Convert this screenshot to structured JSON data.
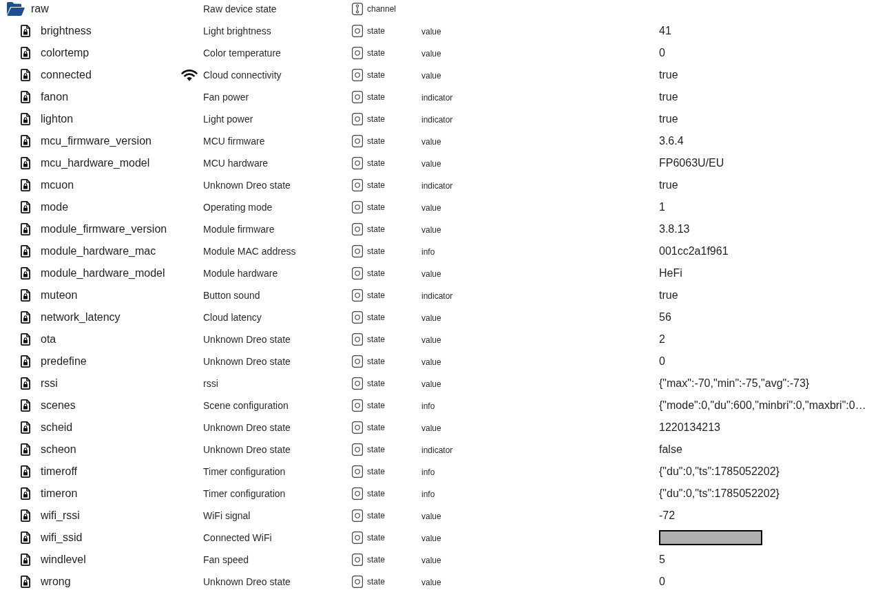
{
  "tree": {
    "name": "raw",
    "kind": "channel",
    "expanded": true,
    "has_icon": false,
    "description": "Raw device state",
    "type": "channel",
    "children": [
      {
        "name": "brightness",
        "kind": "state",
        "has_icon": false,
        "description": "Light brightness",
        "type": "state",
        "role": "value",
        "value": "41",
        "redacted": false
      },
      {
        "name": "colortemp",
        "kind": "state",
        "has_icon": false,
        "description": "Color temperature",
        "type": "state",
        "role": "value",
        "value": "0",
        "redacted": false
      },
      {
        "name": "connected",
        "kind": "state",
        "has_icon": true,
        "description": "Cloud connectivity",
        "type": "state",
        "role": "value",
        "value": "true",
        "redacted": false
      },
      {
        "name": "fanon",
        "kind": "state",
        "has_icon": false,
        "description": "Fan power",
        "type": "state",
        "role": "indicator",
        "value": "true",
        "redacted": false
      },
      {
        "name": "lighton",
        "kind": "state",
        "has_icon": false,
        "description": "Light power",
        "type": "state",
        "role": "indicator",
        "value": "true",
        "redacted": false
      },
      {
        "name": "mcu_firmware_version",
        "kind": "state",
        "has_icon": false,
        "description": "MCU firmware",
        "type": "state",
        "role": "value",
        "value": "3.6.4",
        "redacted": false
      },
      {
        "name": "mcu_hardware_model",
        "kind": "state",
        "has_icon": false,
        "description": "MCU hardware",
        "type": "state",
        "role": "value",
        "value": "FP6063U/EU",
        "redacted": false
      },
      {
        "name": "mcuon",
        "kind": "state",
        "has_icon": false,
        "description": "Unknown Dreo state",
        "type": "state",
        "role": "indicator",
        "value": "true",
        "redacted": false
      },
      {
        "name": "mode",
        "kind": "state",
        "has_icon": false,
        "description": "Operating mode",
        "type": "state",
        "role": "value",
        "value": "1",
        "redacted": false
      },
      {
        "name": "module_firmware_version",
        "kind": "state",
        "has_icon": false,
        "description": "Module firmware",
        "type": "state",
        "role": "value",
        "value": "3.8.13",
        "redacted": false
      },
      {
        "name": "module_hardware_mac",
        "kind": "state",
        "has_icon": false,
        "description": "Module MAC address",
        "type": "state",
        "role": "info",
        "value": "001cc2a1f961",
        "redacted": false
      },
      {
        "name": "module_hardware_model",
        "kind": "state",
        "has_icon": false,
        "description": "Module hardware",
        "type": "state",
        "role": "value",
        "value": "HeFi",
        "redacted": false
      },
      {
        "name": "muteon",
        "kind": "state",
        "has_icon": false,
        "description": "Button sound",
        "type": "state",
        "role": "indicator",
        "value": "true",
        "redacted": false
      },
      {
        "name": "network_latency",
        "kind": "state",
        "has_icon": false,
        "description": "Cloud latency",
        "type": "state",
        "role": "value",
        "value": "56",
        "redacted": false
      },
      {
        "name": "ota",
        "kind": "state",
        "has_icon": false,
        "description": "Unknown Dreo state",
        "type": "state",
        "role": "value",
        "value": "2",
        "redacted": false
      },
      {
        "name": "predefine",
        "kind": "state",
        "has_icon": false,
        "description": "Unknown Dreo state",
        "type": "state",
        "role": "value",
        "value": "0",
        "redacted": false
      },
      {
        "name": "rssi",
        "kind": "state",
        "has_icon": false,
        "description": "rssi",
        "type": "state",
        "role": "value",
        "value": "{\"max\":-70,\"min\":-75,\"avg\":-73}",
        "redacted": false
      },
      {
        "name": "scenes",
        "kind": "state",
        "has_icon": false,
        "description": "Scene configuration",
        "type": "state",
        "role": "info",
        "value": "{\"mode\":0,\"du\":600,\"minbri\":0,\"maxbri\":0…",
        "redacted": false
      },
      {
        "name": "scheid",
        "kind": "state",
        "has_icon": false,
        "description": "Unknown Dreo state",
        "type": "state",
        "role": "value",
        "value": "1220134213",
        "redacted": false
      },
      {
        "name": "scheon",
        "kind": "state",
        "has_icon": false,
        "description": "Unknown Dreo state",
        "type": "state",
        "role": "indicator",
        "value": "false",
        "redacted": false
      },
      {
        "name": "timeroff",
        "kind": "state",
        "has_icon": false,
        "description": "Timer configuration",
        "type": "state",
        "role": "info",
        "value": "{\"du\":0,\"ts\":1785052202}",
        "redacted": false
      },
      {
        "name": "timeron",
        "kind": "state",
        "has_icon": false,
        "description": "Timer configuration",
        "type": "state",
        "role": "info",
        "value": "{\"du\":0,\"ts\":1785052202}",
        "redacted": false
      },
      {
        "name": "wifi_rssi",
        "kind": "state",
        "has_icon": false,
        "description": "WiFi signal",
        "type": "state",
        "role": "value",
        "value": "-72",
        "redacted": false
      },
      {
        "name": "wifi_ssid",
        "kind": "state",
        "has_icon": false,
        "description": "Connected WiFi",
        "type": "state",
        "role": "value",
        "redacted": true
      },
      {
        "name": "windlevel",
        "kind": "state",
        "has_icon": false,
        "description": "Fan speed",
        "type": "state",
        "role": "value",
        "value": "5",
        "redacted": false
      },
      {
        "name": "wrong",
        "kind": "state",
        "has_icon": false,
        "description": "Unknown Dreo state",
        "type": "state",
        "role": "value",
        "value": "0",
        "redacted": false
      }
    ]
  }
}
